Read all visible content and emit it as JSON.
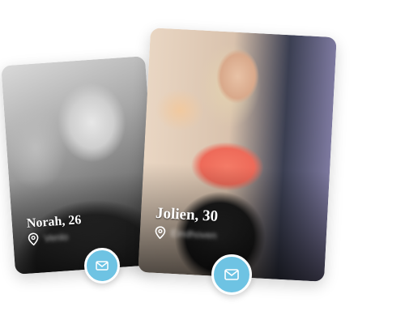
{
  "profiles": [
    {
      "name_age": "Norah, 26",
      "location": "Venlo",
      "icon_location": "map-pin-icon",
      "icon_message": "envelope-icon"
    },
    {
      "name_age": "Jolien, 30",
      "location": "Eindhoven",
      "icon_location": "map-pin-icon",
      "icon_message": "envelope-icon"
    }
  ],
  "colors": {
    "message_button": "#6ec3e3",
    "name_text": "#ffffff",
    "background": "#ffffff"
  }
}
